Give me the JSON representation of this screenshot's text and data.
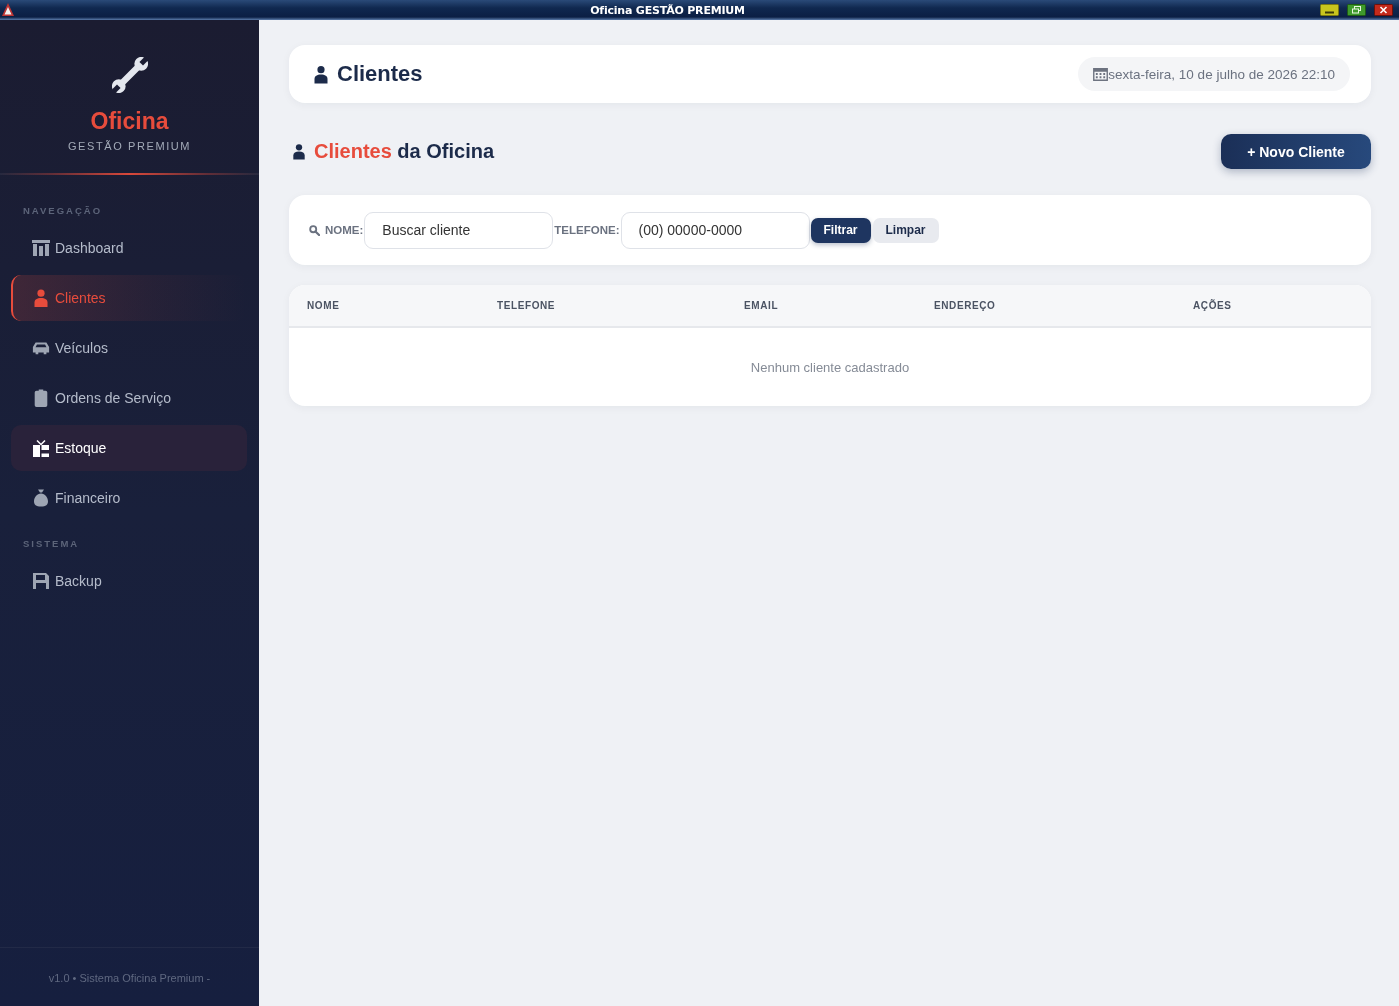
{
  "window": {
    "title": "Oficina GESTÃO PREMIUM"
  },
  "sidebar": {
    "brand": "Oficina",
    "tagline": "GESTÃO PREMIUM",
    "sections": [
      {
        "title": "NAVEGAÇÃO",
        "items": [
          {
            "label": "Dashboard",
            "selected": false,
            "hovered": false
          },
          {
            "label": "Clientes",
            "selected": true,
            "hovered": false
          },
          {
            "label": "Veículos",
            "selected": false,
            "hovered": false
          },
          {
            "label": "Ordens de Serviço",
            "selected": false,
            "hovered": false
          },
          {
            "label": "Estoque",
            "selected": false,
            "hovered": true
          },
          {
            "label": "Financeiro",
            "selected": false,
            "hovered": false
          }
        ]
      },
      {
        "title": "SISTEMA",
        "items": [
          {
            "label": "Backup",
            "selected": false,
            "hovered": false
          }
        ]
      }
    ],
    "footer": "v1.0 • Sistema Oficina Premium -"
  },
  "header": {
    "title": "Clientes",
    "date": "sexta-feira, 10 de julho de 2026 22:10"
  },
  "section": {
    "title_highlight": "Clientes",
    "title_rest": "da Oficina",
    "action": "+ Novo Cliente"
  },
  "filters": {
    "fields": [
      {
        "label": "NOME:",
        "placeholder": "Buscar cliente"
      },
      {
        "label": "TELEFONE:",
        "placeholder": "(00) 00000-0000"
      }
    ],
    "buttons": [
      {
        "label": "Filtrar",
        "kind": "primary"
      },
      {
        "label": "Limpar",
        "kind": "secondary"
      }
    ]
  },
  "table": {
    "columns": [
      "NOME",
      "TELEFONE",
      "EMAIL",
      "ENDEREÇO",
      "AÇÕES"
    ],
    "empty_message": "Nenhum cliente cadastrado"
  }
}
